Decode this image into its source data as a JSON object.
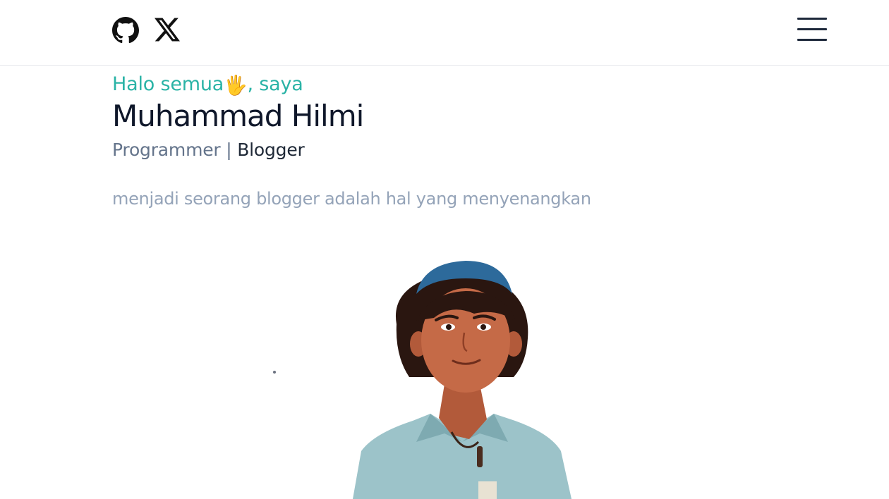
{
  "header": {
    "github_icon": "github-icon",
    "x_icon": "x-logo-icon",
    "menu_icon": "hamburger-menu-icon"
  },
  "hero": {
    "greeting_prefix": "Halo semua",
    "greeting_emoji": "🖐",
    "greeting_suffix": ", saya",
    "name": "Muhammad Hilmi",
    "role_1": "Programmer",
    "role_separator": " | ",
    "role_2": "Blogger",
    "tagline": "menjadi seorang blogger adalah hal yang menyenangkan"
  },
  "colors": {
    "accent": "#2ab3a6",
    "name": "#0f172a",
    "muted": "#64748b",
    "tagline": "#94a3b8"
  }
}
